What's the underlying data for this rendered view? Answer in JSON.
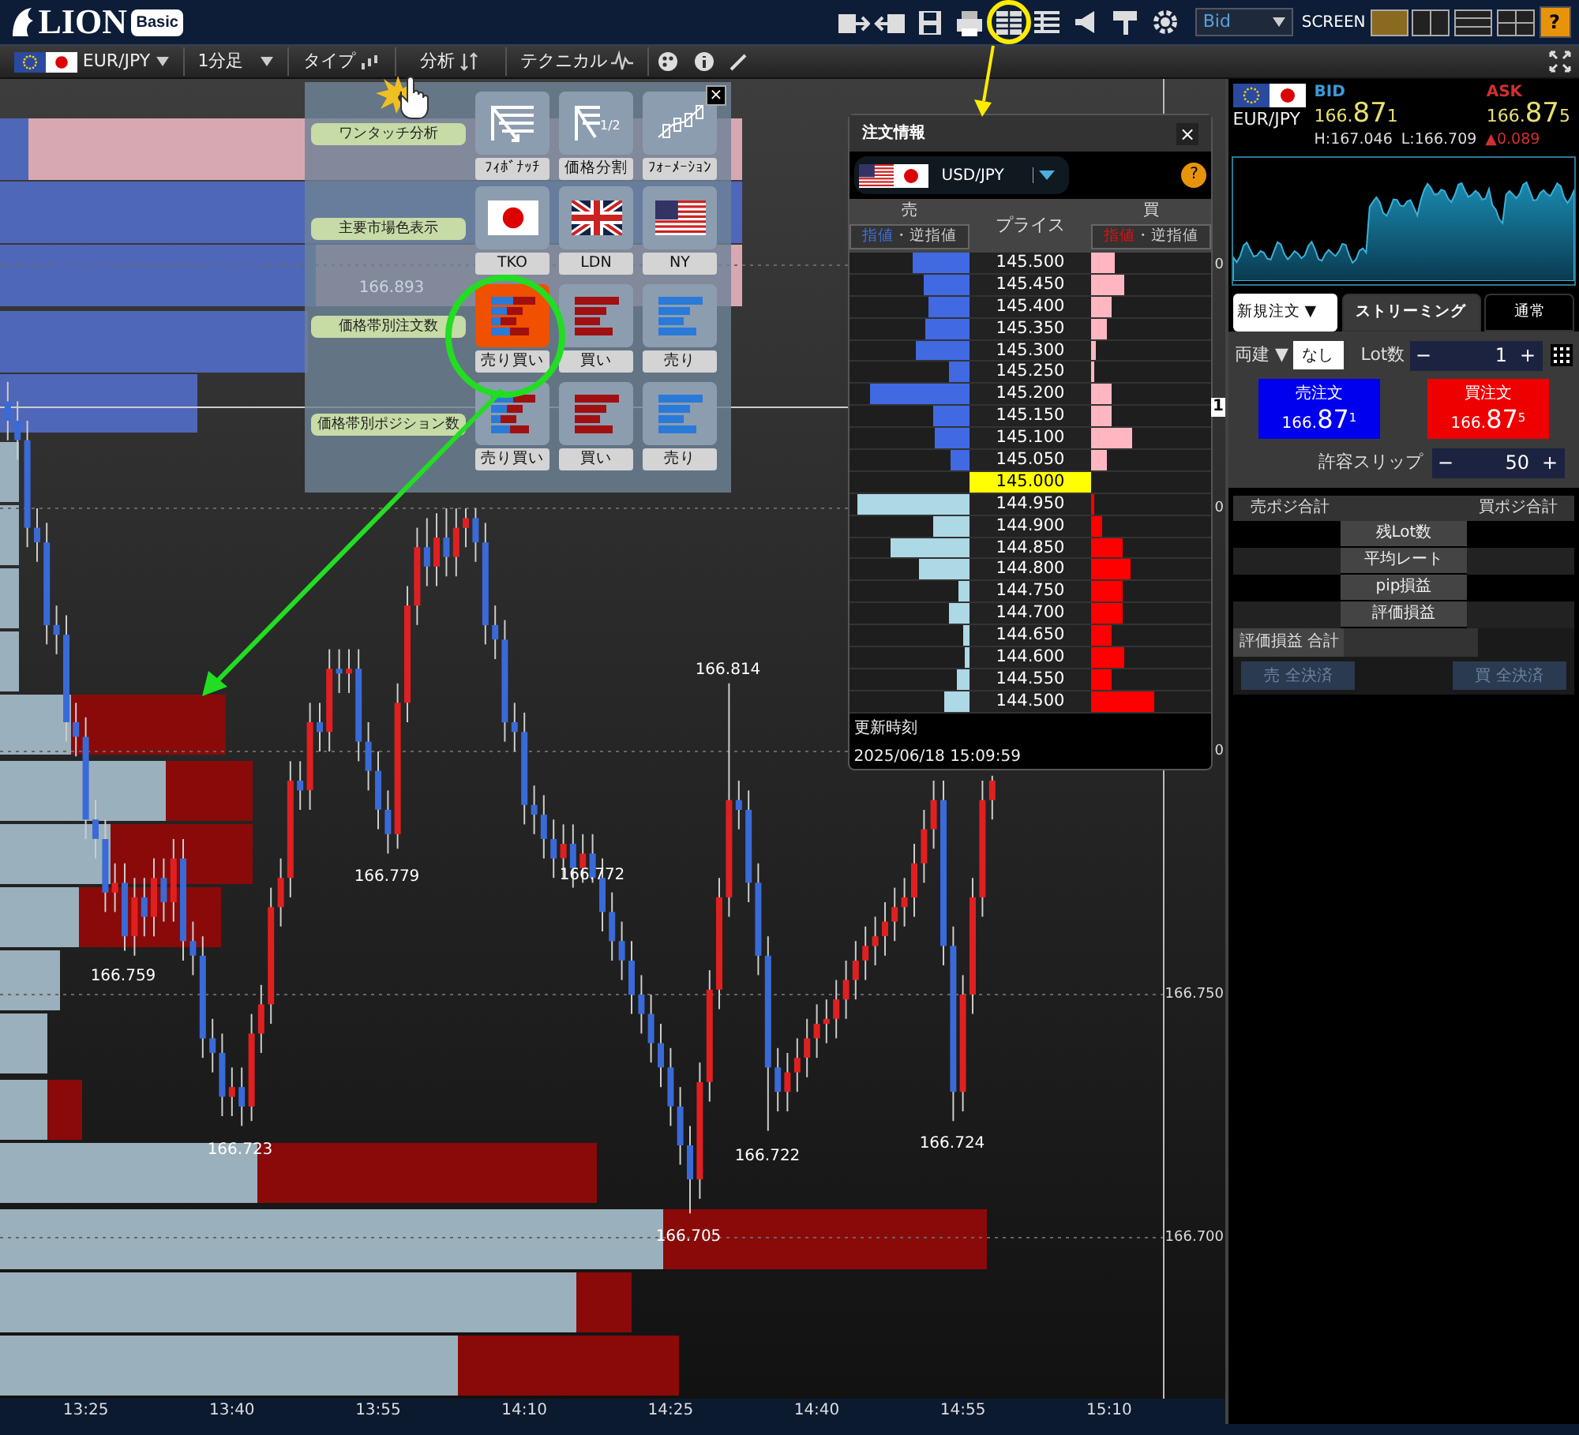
{
  "header": {
    "logo": "LION",
    "edition": "Basic",
    "price_type": "Bid",
    "screen_label": "SCREEN",
    "help": "?"
  },
  "toolbar": {
    "pair": "EUR/JPY",
    "timeframe": "1分足",
    "menus": [
      "タイプ",
      "分析",
      "テクニカル"
    ]
  },
  "chart": {
    "crosshair_label": "1",
    "axis_fragments": [
      "0",
      "0",
      "0"
    ],
    "chart_data": {
      "type": "candlestick",
      "x": [
        797,
        798,
        799,
        800,
        801,
        802,
        803,
        804,
        805,
        806,
        807,
        808,
        809,
        810,
        811,
        812,
        813,
        814,
        815,
        816,
        817,
        818,
        819,
        820,
        821,
        822,
        823,
        824,
        825,
        826,
        827,
        828,
        829,
        830,
        831,
        832,
        833,
        834,
        835,
        836,
        837,
        838,
        839,
        840,
        841,
        842,
        843,
        844,
        845,
        846,
        847,
        848,
        849,
        850,
        851,
        852,
        853,
        854,
        855,
        856,
        857,
        858,
        859,
        860,
        861,
        862,
        863,
        864,
        865,
        866,
        867,
        868,
        869,
        870,
        871,
        872,
        873,
        874,
        875,
        876,
        877,
        878,
        879,
        880,
        881,
        882,
        883,
        884,
        885,
        886,
        887,
        888,
        889,
        890,
        891,
        892,
        893,
        894,
        895,
        896,
        897,
        898
      ],
      "ohlc": [
        [
          166.872,
          166.876,
          166.864,
          166.868
        ],
        [
          166.868,
          166.872,
          166.86,
          166.864
        ],
        [
          166.864,
          166.868,
          166.842,
          166.846
        ],
        [
          166.846,
          166.85,
          166.839,
          166.843
        ],
        [
          166.843,
          166.847,
          166.822,
          166.826
        ],
        [
          166.826,
          166.83,
          166.82,
          166.824
        ],
        [
          166.824,
          166.828,
          166.802,
          166.806
        ],
        [
          166.806,
          166.81,
          166.799,
          166.803
        ],
        [
          166.803,
          166.807,
          166.782,
          166.786
        ],
        [
          166.786,
          166.79,
          166.778,
          166.782
        ],
        [
          166.782,
          166.786,
          166.767,
          166.771
        ],
        [
          166.771,
          166.777,
          166.767,
          166.773
        ],
        [
          166.773,
          166.777,
          166.759,
          166.762
        ],
        [
          166.762,
          166.774,
          166.758,
          166.77
        ],
        [
          166.77,
          166.774,
          166.762,
          166.766
        ],
        [
          166.766,
          166.778,
          166.762,
          166.774
        ],
        [
          166.774,
          166.778,
          166.765,
          166.769
        ],
        [
          166.769,
          166.782,
          166.765,
          166.778
        ],
        [
          166.778,
          166.782,
          166.757,
          166.761
        ],
        [
          166.761,
          166.765,
          166.754,
          166.758
        ],
        [
          166.758,
          166.762,
          166.737,
          166.741
        ],
        [
          166.741,
          166.745,
          166.734,
          166.738
        ],
        [
          166.738,
          166.742,
          166.725,
          166.729
        ],
        [
          166.729,
          166.735,
          166.725,
          166.731
        ],
        [
          166.731,
          166.735,
          166.723,
          166.727
        ],
        [
          166.727,
          166.746,
          166.724,
          166.742
        ],
        [
          166.742,
          166.752,
          166.738,
          166.748
        ],
        [
          166.748,
          166.772,
          166.744,
          166.768
        ],
        [
          166.768,
          166.778,
          166.764,
          166.774
        ],
        [
          166.774,
          166.798,
          166.77,
          166.794
        ],
        [
          166.794,
          166.798,
          166.788,
          166.792
        ],
        [
          166.792,
          166.81,
          166.788,
          166.806
        ],
        [
          166.806,
          166.81,
          166.8,
          166.804
        ],
        [
          166.804,
          166.821,
          166.8,
          166.817
        ],
        [
          166.817,
          166.821,
          166.812,
          166.816
        ],
        [
          166.816,
          166.821,
          166.812,
          166.817
        ],
        [
          166.817,
          166.821,
          166.798,
          166.802
        ],
        [
          166.802,
          166.806,
          166.792,
          166.796
        ],
        [
          166.796,
          166.8,
          166.784,
          166.788
        ],
        [
          166.788,
          166.792,
          166.779,
          166.783
        ],
        [
          166.783,
          166.814,
          166.78,
          166.81
        ],
        [
          166.81,
          166.834,
          166.806,
          166.83
        ],
        [
          166.83,
          166.846,
          166.826,
          166.842
        ],
        [
          166.842,
          166.848,
          166.834,
          166.838
        ],
        [
          166.838,
          166.849,
          166.834,
          166.844
        ],
        [
          166.844,
          166.85,
          166.836,
          166.84
        ],
        [
          166.84,
          166.85,
          166.836,
          166.846
        ],
        [
          166.846,
          166.85,
          166.842,
          166.848
        ],
        [
          166.848,
          166.85,
          166.839,
          166.843
        ],
        [
          166.843,
          166.847,
          166.822,
          166.826
        ],
        [
          166.826,
          166.83,
          166.819,
          166.823
        ],
        [
          166.823,
          166.827,
          166.802,
          166.806
        ],
        [
          166.806,
          166.81,
          166.8,
          166.804
        ],
        [
          166.804,
          166.808,
          166.785,
          166.789
        ],
        [
          166.789,
          166.793,
          166.783,
          166.787
        ],
        [
          166.787,
          166.791,
          166.778,
          166.782
        ],
        [
          166.782,
          166.786,
          166.774,
          166.778
        ],
        [
          166.778,
          166.785,
          166.774,
          166.781
        ],
        [
          166.781,
          166.785,
          166.772,
          166.776
        ],
        [
          166.776,
          166.783,
          166.773,
          166.779
        ],
        [
          166.779,
          166.783,
          166.773,
          166.774
        ],
        [
          166.774,
          166.778,
          166.763,
          166.767
        ],
        [
          166.767,
          166.771,
          166.757,
          166.761
        ],
        [
          166.761,
          166.765,
          166.753,
          166.757
        ],
        [
          166.757,
          166.761,
          166.746,
          166.75
        ],
        [
          166.75,
          166.754,
          166.742,
          166.746
        ],
        [
          166.746,
          166.75,
          166.736,
          166.74
        ],
        [
          166.74,
          166.744,
          166.731,
          166.735
        ],
        [
          166.735,
          166.739,
          166.723,
          166.727
        ],
        [
          166.727,
          166.731,
          166.715,
          166.719
        ],
        [
          166.719,
          166.723,
          166.705,
          166.712
        ],
        [
          166.712,
          166.736,
          166.708,
          166.732
        ],
        [
          166.732,
          166.755,
          166.728,
          166.751
        ],
        [
          166.751,
          166.774,
          166.747,
          166.77
        ],
        [
          166.77,
          166.814,
          166.766,
          166.79
        ],
        [
          166.79,
          166.794,
          166.784,
          166.788
        ],
        [
          166.788,
          166.792,
          166.769,
          166.773
        ],
        [
          166.773,
          166.777,
          166.754,
          166.758
        ],
        [
          166.758,
          166.762,
          166.722,
          166.735
        ],
        [
          166.735,
          166.739,
          166.726,
          166.73
        ],
        [
          166.73,
          166.738,
          166.726,
          166.734
        ],
        [
          166.734,
          166.741,
          166.73,
          166.737
        ],
        [
          166.737,
          166.745,
          166.733,
          166.741
        ],
        [
          166.741,
          166.748,
          166.737,
          166.744
        ],
        [
          166.744,
          166.749,
          166.74,
          166.745
        ],
        [
          166.745,
          166.753,
          166.741,
          166.749
        ],
        [
          166.749,
          166.757,
          166.745,
          166.753
        ],
        [
          166.753,
          166.761,
          166.749,
          166.757
        ],
        [
          166.757,
          166.764,
          166.753,
          166.76
        ],
        [
          166.76,
          166.766,
          166.756,
          166.762
        ],
        [
          166.762,
          166.769,
          166.758,
          166.765
        ],
        [
          166.765,
          166.772,
          166.761,
          166.768
        ],
        [
          166.768,
          166.774,
          166.764,
          166.77
        ],
        [
          166.77,
          166.781,
          166.766,
          166.777
        ],
        [
          166.777,
          166.788,
          166.773,
          166.784
        ],
        [
          166.784,
          166.794,
          166.78,
          166.79
        ],
        [
          166.79,
          166.794,
          166.756,
          166.76
        ],
        [
          166.76,
          166.764,
          166.724,
          166.73
        ],
        [
          166.73,
          166.754,
          166.726,
          166.75
        ],
        [
          166.75,
          166.774,
          166.746,
          166.77
        ],
        [
          166.77,
          166.794,
          166.766,
          166.79
        ],
        [
          166.79,
          166.795,
          166.786,
          166.794
        ]
      ],
      "xlim": [
        796.2,
        915.6
      ],
      "ylim": [
        166.6669,
        166.9383
      ],
      "xticks": [
        {
          "value": 805,
          "label": "13:25"
        },
        {
          "value": 820,
          "label": "13:40"
        },
        {
          "value": 835,
          "label": "13:55"
        },
        {
          "value": 850,
          "label": "14:10"
        },
        {
          "value": 865,
          "label": "14:25"
        },
        {
          "value": 880,
          "label": "14:40"
        },
        {
          "value": 895,
          "label": "14:55"
        },
        {
          "value": 910,
          "label": "15:10"
        }
      ],
      "yticks": [
        {
          "value": 166.75,
          "label": "166.750"
        },
        {
          "value": 166.7,
          "label": "166.700"
        }
      ],
      "annotations": [
        "166.893",
        "166.814",
        "166.779",
        "166.772",
        "166.759",
        "166.723",
        "166.722",
        "166.724",
        "166.705"
      ]
    }
  },
  "analysis_menu": {
    "close": "×",
    "rows": [
      {
        "label": "ワンタッチ分析",
        "options": [
          {
            "label": "ﾌｨﾎﾞﾅｯﾁ",
            "selected": false
          },
          {
            "icon_text": "1/2",
            "label": "価格分割",
            "selected": false
          },
          {
            "label": "ﾌｫｰﾒｰｼｮﾝ",
            "selected": false
          }
        ]
      },
      {
        "label": "主要市場色表示",
        "options": [
          {
            "label": "TKO",
            "selected": false
          },
          {
            "label": "LDN",
            "selected": false
          },
          {
            "label": "NY",
            "selected": false
          }
        ]
      },
      {
        "label": "価格帯別注文数",
        "options": [
          {
            "label": "売り買い",
            "selected": true
          },
          {
            "label": "買い",
            "selected": false
          },
          {
            "label": "売り",
            "selected": false
          }
        ]
      },
      {
        "label": "価格帯別ポジション数",
        "options": [
          {
            "label": "売り買い",
            "selected": false
          },
          {
            "label": "買い",
            "selected": false
          },
          {
            "label": "売り",
            "selected": false
          }
        ]
      }
    ]
  },
  "order_info": {
    "title": "注文情報",
    "close": "×",
    "pair": "USD/JPY",
    "help": "?",
    "sell_header": "売",
    "price_header": "プライス",
    "buy_header": "買",
    "sell_filter": [
      {
        "text": "指値",
        "kind": "limit"
      },
      {
        "text": "・逆指値",
        "kind": "stop"
      }
    ],
    "buy_filter": [
      {
        "text": "指値",
        "kind": "limit"
      },
      {
        "text": "・逆指値",
        "kind": "stop"
      }
    ],
    "rows": [
      {
        "price": "145.500",
        "kind": "above",
        "sell": {
          "level": 0.47
        },
        "buy": {
          "level": 0.2
        }
      },
      {
        "price": "145.450",
        "kind": "above",
        "sell": {
          "level": 0.38
        },
        "buy": {
          "level": 0.28
        }
      },
      {
        "price": "145.400",
        "kind": "above",
        "sell": {
          "level": 0.34
        },
        "buy": {
          "level": 0.17
        }
      },
      {
        "price": "145.350",
        "kind": "above",
        "sell": {
          "level": 0.37
        },
        "buy": {
          "level": 0.14
        }
      },
      {
        "price": "145.300",
        "kind": "above",
        "sell": {
          "level": 0.45
        },
        "buy": {
          "level": 0.04
        }
      },
      {
        "price": "145.250",
        "kind": "above",
        "sell": {
          "level": 0.18
        },
        "buy": {
          "level": 0.03
        }
      },
      {
        "price": "145.200",
        "kind": "above",
        "sell": {
          "level": 0.83
        },
        "buy": {
          "level": 0.18
        }
      },
      {
        "price": "145.150",
        "kind": "above",
        "sell": {
          "level": 0.31
        },
        "buy": {
          "level": 0.18
        }
      },
      {
        "price": "145.100",
        "kind": "above",
        "sell": {
          "level": 0.29
        },
        "buy": {
          "level": 0.35
        }
      },
      {
        "price": "145.050",
        "kind": "above",
        "sell": {
          "level": 0.16
        },
        "buy": {
          "level": 0.14
        }
      },
      {
        "price": "145.000",
        "kind": "current"
      },
      {
        "price": "144.950",
        "kind": "below",
        "sell": {
          "level": 0.93
        },
        "buy": {
          "level": 0.03
        }
      },
      {
        "price": "144.900",
        "kind": "below",
        "sell": {
          "level": 0.3
        },
        "buy": {
          "level": 0.1
        }
      },
      {
        "price": "144.850",
        "kind": "below",
        "sell": {
          "level": 0.66
        },
        "buy": {
          "level": 0.27
        }
      },
      {
        "price": "144.800",
        "kind": "below",
        "sell": {
          "level": 0.43
        },
        "buy": {
          "level": 0.33
        }
      },
      {
        "price": "144.750",
        "kind": "below",
        "sell": {
          "level": 0.09
        },
        "buy": {
          "level": 0.26
        }
      },
      {
        "price": "144.700",
        "kind": "below",
        "sell": {
          "level": 0.17
        },
        "buy": {
          "level": 0.27
        }
      },
      {
        "price": "144.650",
        "kind": "below",
        "sell": {
          "level": 0.06
        },
        "buy": {
          "level": 0.17
        }
      },
      {
        "price": "144.600",
        "kind": "below",
        "sell": {
          "level": 0.05
        },
        "buy": {
          "level": 0.28
        }
      },
      {
        "price": "144.550",
        "kind": "below",
        "sell": {
          "level": 0.11
        },
        "buy": {
          "level": 0.17
        }
      },
      {
        "price": "144.500",
        "kind": "below",
        "sell": {
          "level": 0.22
        },
        "buy": {
          "level": 0.53
        }
      }
    ],
    "updated_label": "更新時刻",
    "updated_at": "2025/06/18 15:09:59"
  },
  "trade_panel": {
    "pair": "EUR/JPY",
    "bid": {
      "label": "BID",
      "prefix": "166.",
      "pips": "87",
      "fraction": "1"
    },
    "ask": {
      "label": "ASK",
      "prefix": "166.",
      "pips": "87",
      "fraction": "5"
    },
    "high": "H:167.046",
    "low": "L:166.709",
    "change": "▲0.089",
    "tabs": [
      {
        "label": "新規注文",
        "caret": "▼",
        "kind": "dropdown",
        "selected": false
      },
      {
        "label": "ストリーミング",
        "kind": "tab",
        "selected": true
      },
      {
        "label": "通常",
        "kind": "tab",
        "selected": false
      }
    ],
    "hedge": {
      "label": "両建 ▼",
      "value": "なし"
    },
    "lot": {
      "label": "Lot数",
      "minus": "−",
      "value": "1",
      "plus": "+"
    },
    "sell_order": {
      "label": "売注文",
      "prefix": "166.",
      "pips": "87",
      "fraction": "1"
    },
    "buy_order": {
      "label": "買注文",
      "prefix": "166.",
      "pips": "87",
      "fraction": "5"
    },
    "slippage": {
      "label": "許容スリップ",
      "minus": "−",
      "value": "50",
      "plus": "+"
    },
    "positions": {
      "sell_header": "売ポジ合計",
      "buy_header": "買ポジ合計",
      "rows": [
        "残Lot数",
        "平均レート",
        "pip損益",
        "評価損益"
      ],
      "total_label": "評価損益 合計",
      "close_buttons": [
        {
          "label": "売 全決済",
          "disabled": true
        },
        {
          "label": "買 全決済",
          "disabled": true
        }
      ]
    }
  }
}
